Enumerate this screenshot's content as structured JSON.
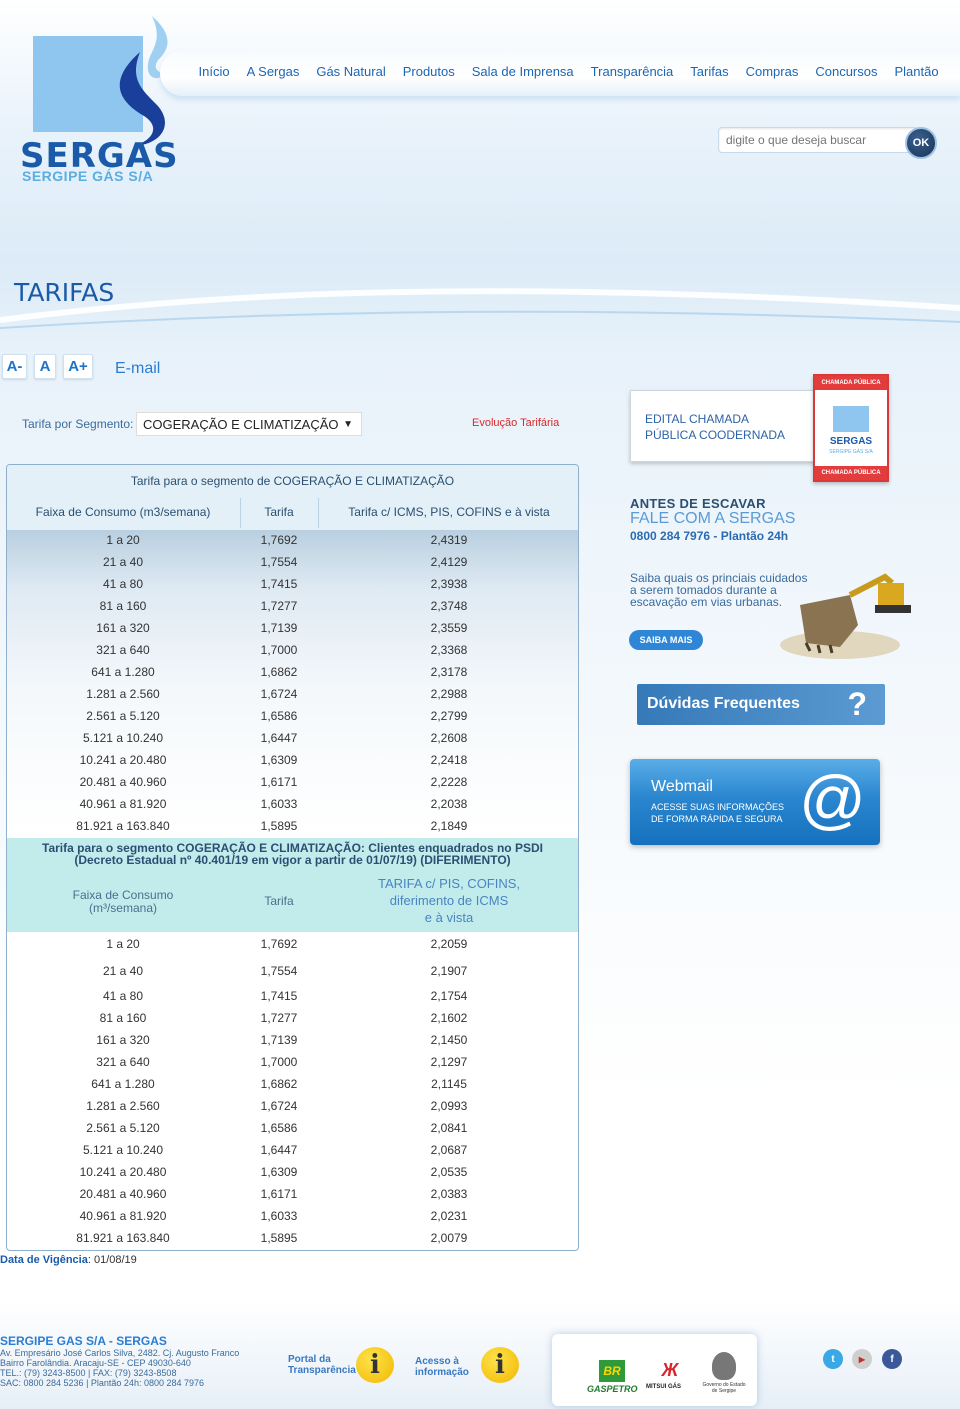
{
  "brand": {
    "name": "SERGAS",
    "tagline": "SERGIPE GÁS S/A",
    "colors": {
      "primary": "#1a5aa8",
      "light": "#8fc6ef"
    }
  },
  "nav": [
    "Início",
    "A Sergas",
    "Gás Natural",
    "Produtos",
    "Sala de Imprensa",
    "Transparência",
    "Tarifas",
    "Compras",
    "Concursos",
    "Plantão"
  ],
  "search": {
    "placeholder": "digite o que deseja buscar",
    "button": "OK"
  },
  "page_title": "TARIFAS",
  "font_controls": {
    "decrease": "A-",
    "normal": "A",
    "increase": "A+",
    "email": "E-mail"
  },
  "segment": {
    "label": "Tarifa por Segmento:",
    "selected": "COGERAÇÃO E CLIMATIZAÇÃO",
    "evolution_link": "Evolução Tarifária"
  },
  "table1": {
    "title": "Tarifa para o segmento de COGERAÇÃO E CLIMATIZAÇÃO",
    "headers": [
      "Faixa de Consumo (m3/semana)",
      "Tarifa",
      "Tarifa c/ ICMS, PIS, COFINS e à vista"
    ],
    "rows": [
      [
        "1 a 20",
        "1,7692",
        "2,4319"
      ],
      [
        "21 a 40",
        "1,7554",
        "2,4129"
      ],
      [
        "41 a 80",
        "1,7415",
        "2,3938"
      ],
      [
        "81 a 160",
        "1,7277",
        "2,3748"
      ],
      [
        "161 a 320",
        "1,7139",
        "2,3559"
      ],
      [
        "321 a 640",
        "1,7000",
        "2,3368"
      ],
      [
        "641 a 1.280",
        "1,6862",
        "2,3178"
      ],
      [
        "1.281 a 2.560",
        "1,6724",
        "2,2988"
      ],
      [
        "2.561 a 5.120",
        "1,6586",
        "2,2799"
      ],
      [
        "5.121 a 10.240",
        "1,6447",
        "2,2608"
      ],
      [
        "10.241 a 20.480",
        "1,6309",
        "2,2418"
      ],
      [
        "20.481 a 40.960",
        "1,6171",
        "2,2228"
      ],
      [
        "40.961 a 81.920",
        "1,6033",
        "2,2038"
      ],
      [
        "81.921 a 163.840",
        "1,5895",
        "2,1849"
      ]
    ]
  },
  "table2": {
    "title_line1": "Tarifa para o segmento COGERAÇÃO E CLIMATIZAÇÃO: Clientes enquadrados no PSDI",
    "title_line2": "(Decreto Estadual nº 40.401/19 em vigor a partir de 01/07/19) (DIFERIMENTO)",
    "header_col1_l1": "Faixa de Consumo",
    "header_col1_l2": "(m³/semana)",
    "header_col2": "Tarifa",
    "header_col3_l1": "TARIFA c/ PIS, COFINS,",
    "header_col3_l2": "diferimento de ICMS",
    "header_col3_l3": "e à vista",
    "rows": [
      [
        "1 a 20",
        "1,7692",
        "2,2059"
      ],
      [
        "21 a 40",
        "1,7554",
        "2,1907"
      ],
      [
        "41 a 80",
        "1,7415",
        "2,1754"
      ],
      [
        "81 a 160",
        "1,7277",
        "2,1602"
      ],
      [
        "161 a 320",
        "1,7139",
        "2,1450"
      ],
      [
        "321 a 640",
        "1,7000",
        "2,1297"
      ],
      [
        "641 a 1.280",
        "1,6862",
        "2,1145"
      ],
      [
        "1.281 a 2.560",
        "1,6724",
        "2,0993"
      ],
      [
        "2.561 a 5.120",
        "1,6586",
        "2,0841"
      ],
      [
        "5.121 a 10.240",
        "1,6447",
        "2,0687"
      ],
      [
        "10.241 a 20.480",
        "1,6309",
        "2,0535"
      ],
      [
        "20.481 a 40.960",
        "1,6171",
        "2,0383"
      ],
      [
        "40.961 a 81.920",
        "1,6033",
        "2,0231"
      ],
      [
        "81.921 a 163.840",
        "1,5895",
        "2,0079"
      ]
    ]
  },
  "vigencia": {
    "label": "Data de Vigência",
    "value": ": 01/08/19"
  },
  "sidebar": {
    "edital_l1": "EDITAL CHAMADA",
    "edital_l2": "PÚBLICA COODERNADA",
    "badge_top": "CHAMADA PÚBLICA",
    "badge_bottom": "CHAMADA PÚBLICA",
    "badge_name": "SERGAS",
    "badge_sub": "SERGIPE GÁS S/A",
    "escavar_title": "ANTES DE ESCAVAR",
    "escavar_sub": "FALE COM A SERGAS",
    "escavar_phone": "0800 284 7976 - Plantão 24h",
    "escavar_text": "Saiba quais os princiais cuidados a serem tomados durante a escavação em vias urbanas.",
    "saiba_mais": "SAIBA MAIS",
    "duvidas": "Dúvidas Frequentes",
    "webmail_title": "Webmail",
    "webmail_l1": "ACESSE SUAS INFORMAÇÕES",
    "webmail_l2": "DE FORMA RÁPIDA E SEGURA"
  },
  "footer": {
    "company": "SERGIPE GAS S/A - SERGAS",
    "addr_l1": "Av. Empresário José Carlos Silva, 2482. Cj. Augusto Franco",
    "addr_l2": "Bairro Farolândia. Aracaju-SE - CEP 49030-640",
    "addr_l3": "TEL.: (79) 3243-8500 | FAX: (79) 3243-8508",
    "addr_l4": "SAC: 0800 284 5236 | Plantão 24h: 0800 284 7976",
    "portal_l1": "Portal da",
    "portal_l2": "Transparência",
    "acesso_l1": "Acesso à",
    "acesso_l2": "informação",
    "partner1": "GASPETRO",
    "partner2": "MITSUI GÁS",
    "partner3_l1": "Governo do Estado",
    "partner3_l2": "de Sergipe"
  }
}
